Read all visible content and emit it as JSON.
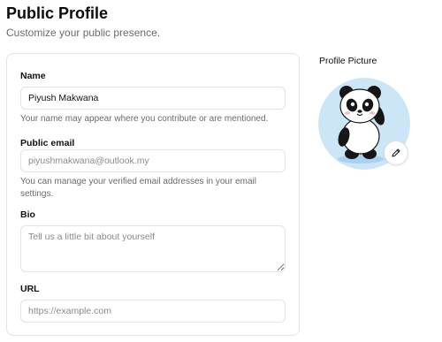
{
  "header": {
    "title": "Public Profile",
    "subtitle": "Customize your public presence."
  },
  "form": {
    "name": {
      "label": "Name",
      "value": "Piyush Makwana",
      "help": "Your name may appear where you contribute or are mentioned."
    },
    "email": {
      "label": "Public email",
      "placeholder": "piyushmakwana@outlook.my",
      "help": "You can manage your verified email addresses in your email settings."
    },
    "bio": {
      "label": "Bio",
      "placeholder": "Tell us a little bit about yourself"
    },
    "url": {
      "label": "URL",
      "placeholder": "https://example.com"
    }
  },
  "profile_picture": {
    "label": "Profile Picture",
    "avatar_icon": "panda-waving",
    "edit_icon": "pencil-icon",
    "background_color": "#cde6f7"
  }
}
